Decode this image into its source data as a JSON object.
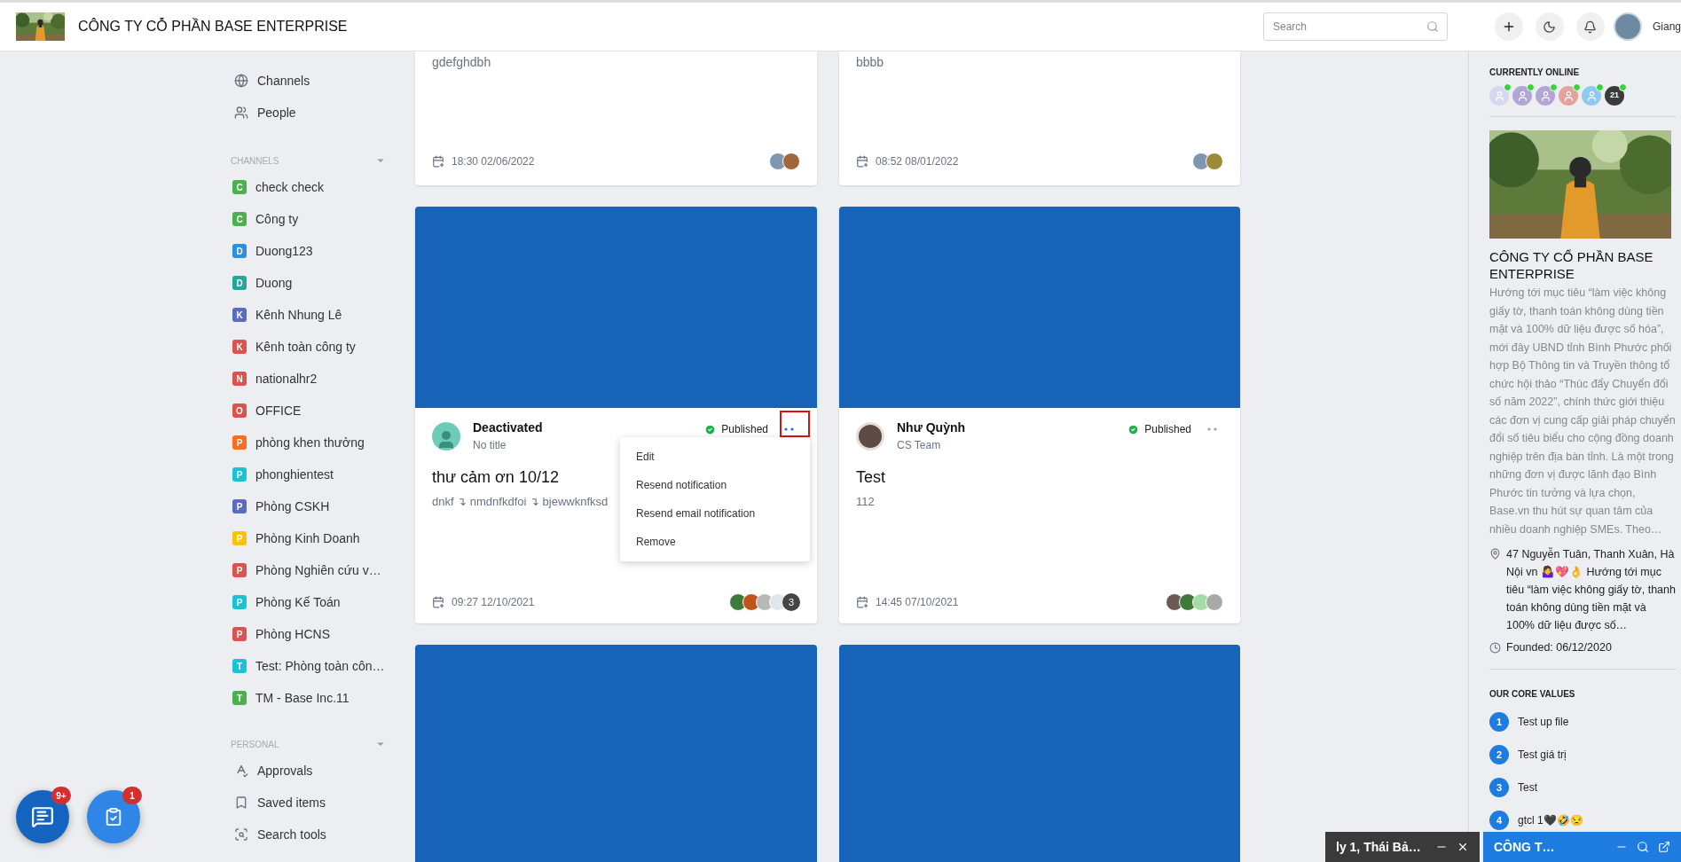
{
  "header": {
    "company": "CÔNG TY CỖ PHẦN BASE ENTERPRISE",
    "search_placeholder": "Search",
    "user": "Giang"
  },
  "sidebar": {
    "nav": [
      {
        "label": "Channels"
      },
      {
        "label": "People"
      }
    ],
    "channels_heading": "CHANNELS",
    "channels": [
      {
        "letter": "C",
        "name": "check check",
        "color": "#4caf50"
      },
      {
        "letter": "C",
        "name": "Công ty",
        "color": "#4caf50"
      },
      {
        "letter": "D",
        "name": "Duong123",
        "color": "#2e8ee0"
      },
      {
        "letter": "D",
        "name": "Duong",
        "color": "#26a69a"
      },
      {
        "letter": "K",
        "name": "Kênh Nhung Lê",
        "color": "#5c6bc0"
      },
      {
        "letter": "K",
        "name": "Kênh toàn công ty",
        "color": "#d9534f"
      },
      {
        "letter": "N",
        "name": "nationalhr2",
        "color": "#d9534f"
      },
      {
        "letter": "O",
        "name": "OFFICE",
        "color": "#d9534f"
      },
      {
        "letter": "P",
        "name": "phòng khen thưởng",
        "color": "#fb6d21"
      },
      {
        "letter": "P",
        "name": "phonghientest",
        "color": "#1ec0d6"
      },
      {
        "letter": "P",
        "name": "Phòng CSKH",
        "color": "#5c6bc0"
      },
      {
        "letter": "P",
        "name": "Phòng Kinh Doanh",
        "color": "#fcc10a"
      },
      {
        "letter": "P",
        "name": "Phòng Nghiên cứu v…",
        "color": "#d9534f"
      },
      {
        "letter": "P",
        "name": "Phòng Kế Toán",
        "color": "#1ec0d6"
      },
      {
        "letter": "P",
        "name": "Phòng HCNS",
        "color": "#d9534f"
      },
      {
        "letter": "T",
        "name": "Test: Phòng toàn côn…",
        "color": "#1ec0d6"
      },
      {
        "letter": "T",
        "name": "TM - Base Inc.11",
        "color": "#4caf50"
      }
    ],
    "personal_heading": "PERSONAL",
    "personal": [
      {
        "label": "Approvals"
      },
      {
        "label": "Saved items"
      },
      {
        "label": "Search tools"
      }
    ]
  },
  "posts": [
    {
      "kind": "partial",
      "excerpt": "gdefghdbh",
      "date": "18:30 02/06/2022",
      "viewers": [
        {
          "color": "#7d97b0"
        },
        {
          "color": "#a0683a"
        }
      ]
    },
    {
      "kind": "partial",
      "excerpt": "bbbb",
      "date": "08:52 08/01/2022",
      "viewers": [
        {
          "color": "#7d97b0"
        },
        {
          "color": "#9a8a3a"
        }
      ]
    },
    {
      "kind": "anonymous",
      "author": "Deactivated",
      "subtitle": "No title",
      "status": "Published",
      "title": "thư cảm ơn 10/12",
      "excerpt": "dnkf ↴ nmdnfkdfoi ↴ bjewwknfksd",
      "date": "09:27 12/10/2021",
      "viewers": [
        {
          "color": "#3f7a3a"
        },
        {
          "color": "#c2531b"
        },
        {
          "color": "#b8b8b8"
        },
        {
          "color": "#e2e6ea"
        }
      ],
      "more": "3",
      "menu_open": true,
      "menu_items": [
        "Edit",
        "Resend notification",
        "Resend email notification",
        "Remove"
      ]
    },
    {
      "kind": "member",
      "author": "Như Quỳnh",
      "subtitle": "CS Team",
      "status": "Published",
      "title": "Test",
      "excerpt": "112",
      "date": "14:45 07/10/2021",
      "viewers": [
        {
          "color": "#6b5a55"
        },
        {
          "color": "#3f7a3a"
        },
        {
          "color": "#a5dba5"
        },
        {
          "color": "#a9a9a9"
        }
      ],
      "menu_open": false
    },
    {
      "kind": "cover"
    },
    {
      "kind": "cover"
    }
  ],
  "online": {
    "heading": "CURRENTLY ONLINE",
    "users": [
      {
        "color": "#d5d8f0"
      },
      {
        "color": "#b2a6d9"
      },
      {
        "color": "#b2a6d9"
      },
      {
        "color": "#e3a39c"
      },
      {
        "color": "#8ccaf2"
      }
    ],
    "more": "21"
  },
  "company": {
    "name": "CÔNG TY CỔ PHẦN BASE ENTERPRISE",
    "description": "Hướng tới mục tiêu “làm việc không giấy tờ, thanh toán không dùng tiền mặt và 100% dữ liệu được số hóa”, mới đây UBND tỉnh Bình Phước phối hợp Bộ Thông tin và Truyền thông tổ chức hội thảo “Thúc đẩy Chuyển đổi số năm 2022”, chính thức giới thiệu các đơn vị cung cấp giải pháp chuyển đổi số tiêu biểu cho cộng đồng doanh nghiệp trên địa bàn tỉnh. Là một trong những đơn vị được lãnh đạo Bình Phước tin tưởng và lựa chọn, Base.vn thu hút sự quan tâm của nhiều doanh nghiệp SMEs. Theo…",
    "address": "47 Nguyễn Tuân, Thanh Xuân, Hà Nội vn 🤷‍♀️💖👌 Hướng tới mục tiêu “làm việc không giấy tờ, thanh toán không dùng tiền mặt và 100% dữ liệu được số…",
    "founded": "Founded: 06/12/2020"
  },
  "core_values": {
    "heading": "OUR CORE VALUES",
    "items": [
      {
        "number": "1",
        "text": "Test up file"
      },
      {
        "number": "2",
        "text": "Test giá trị"
      },
      {
        "number": "3",
        "text": "Test"
      },
      {
        "number": "4",
        "text": "gtcl 1🖤🤣😒"
      }
    ]
  },
  "floating_buttons": [
    {
      "kind": "chat",
      "badge": "9+"
    },
    {
      "kind": "tasks",
      "badge": "1"
    }
  ],
  "chat_tabs": [
    {
      "kind": "dark",
      "title": "ly 1, Thái Bả…"
    },
    {
      "kind": "blue",
      "title": "CÔNG T…"
    }
  ]
}
